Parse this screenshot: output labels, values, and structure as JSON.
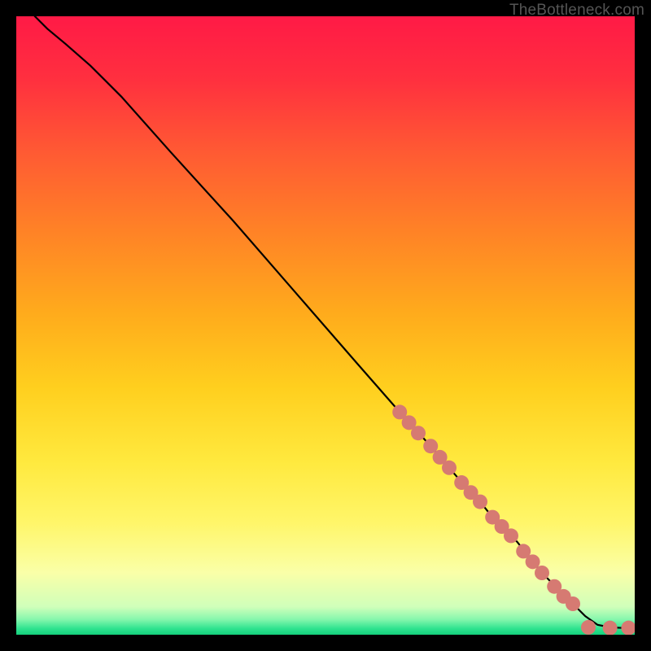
{
  "watermark": {
    "text": "TheBottleneck.com"
  },
  "gradient": {
    "stops": [
      {
        "offset": 0.0,
        "color": "#ff1a46"
      },
      {
        "offset": 0.1,
        "color": "#ff2f3f"
      },
      {
        "offset": 0.22,
        "color": "#ff5a33"
      },
      {
        "offset": 0.35,
        "color": "#ff8326"
      },
      {
        "offset": 0.48,
        "color": "#ffab1c"
      },
      {
        "offset": 0.6,
        "color": "#ffcf1e"
      },
      {
        "offset": 0.72,
        "color": "#ffe93e"
      },
      {
        "offset": 0.82,
        "color": "#fff66a"
      },
      {
        "offset": 0.9,
        "color": "#faffa8"
      },
      {
        "offset": 0.955,
        "color": "#d0ffba"
      },
      {
        "offset": 0.975,
        "color": "#87f7ad"
      },
      {
        "offset": 0.99,
        "color": "#2fe38f"
      },
      {
        "offset": 1.0,
        "color": "#14d07c"
      }
    ]
  },
  "chart_data": {
    "type": "line",
    "title": "",
    "xlabel": "",
    "ylabel": "",
    "xlim": [
      0,
      100
    ],
    "ylim": [
      0,
      100
    ],
    "grid": false,
    "series": [
      {
        "name": "curve",
        "x": [
          3,
          5,
          8,
          12,
          17,
          25,
          35,
          45,
          55,
          62,
          67,
          70,
          73,
          75,
          77,
          79,
          81,
          83,
          85,
          88,
          90,
          92,
          94,
          96,
          98,
          99
        ],
        "y": [
          100,
          98,
          95.5,
          92,
          87,
          78,
          67,
          55.5,
          44,
          36,
          30.5,
          27,
          23.5,
          21.5,
          19,
          17,
          15,
          12.5,
          10,
          7,
          5,
          3,
          1.6,
          1.2,
          1.1,
          1.1
        ]
      }
    ],
    "markers": {
      "name": "highlighted-points",
      "color": "#d67a72",
      "radius_px": 9,
      "points": [
        {
          "x": 62.0,
          "y": 36.0
        },
        {
          "x": 63.5,
          "y": 34.3
        },
        {
          "x": 65.0,
          "y": 32.6
        },
        {
          "x": 67.0,
          "y": 30.5
        },
        {
          "x": 68.5,
          "y": 28.7
        },
        {
          "x": 70.0,
          "y": 27.0
        },
        {
          "x": 72.0,
          "y": 24.6
        },
        {
          "x": 73.5,
          "y": 23.0
        },
        {
          "x": 75.0,
          "y": 21.5
        },
        {
          "x": 77.0,
          "y": 19.0
        },
        {
          "x": 78.5,
          "y": 17.5
        },
        {
          "x": 80.0,
          "y": 16.0
        },
        {
          "x": 82.0,
          "y": 13.5
        },
        {
          "x": 83.5,
          "y": 11.8
        },
        {
          "x": 85.0,
          "y": 10.0
        },
        {
          "x": 87.0,
          "y": 7.8
        },
        {
          "x": 88.5,
          "y": 6.2
        },
        {
          "x": 90.0,
          "y": 5.0
        },
        {
          "x": 92.5,
          "y": 1.2
        },
        {
          "x": 96.0,
          "y": 1.1
        },
        {
          "x": 99.0,
          "y": 1.1
        }
      ]
    }
  }
}
